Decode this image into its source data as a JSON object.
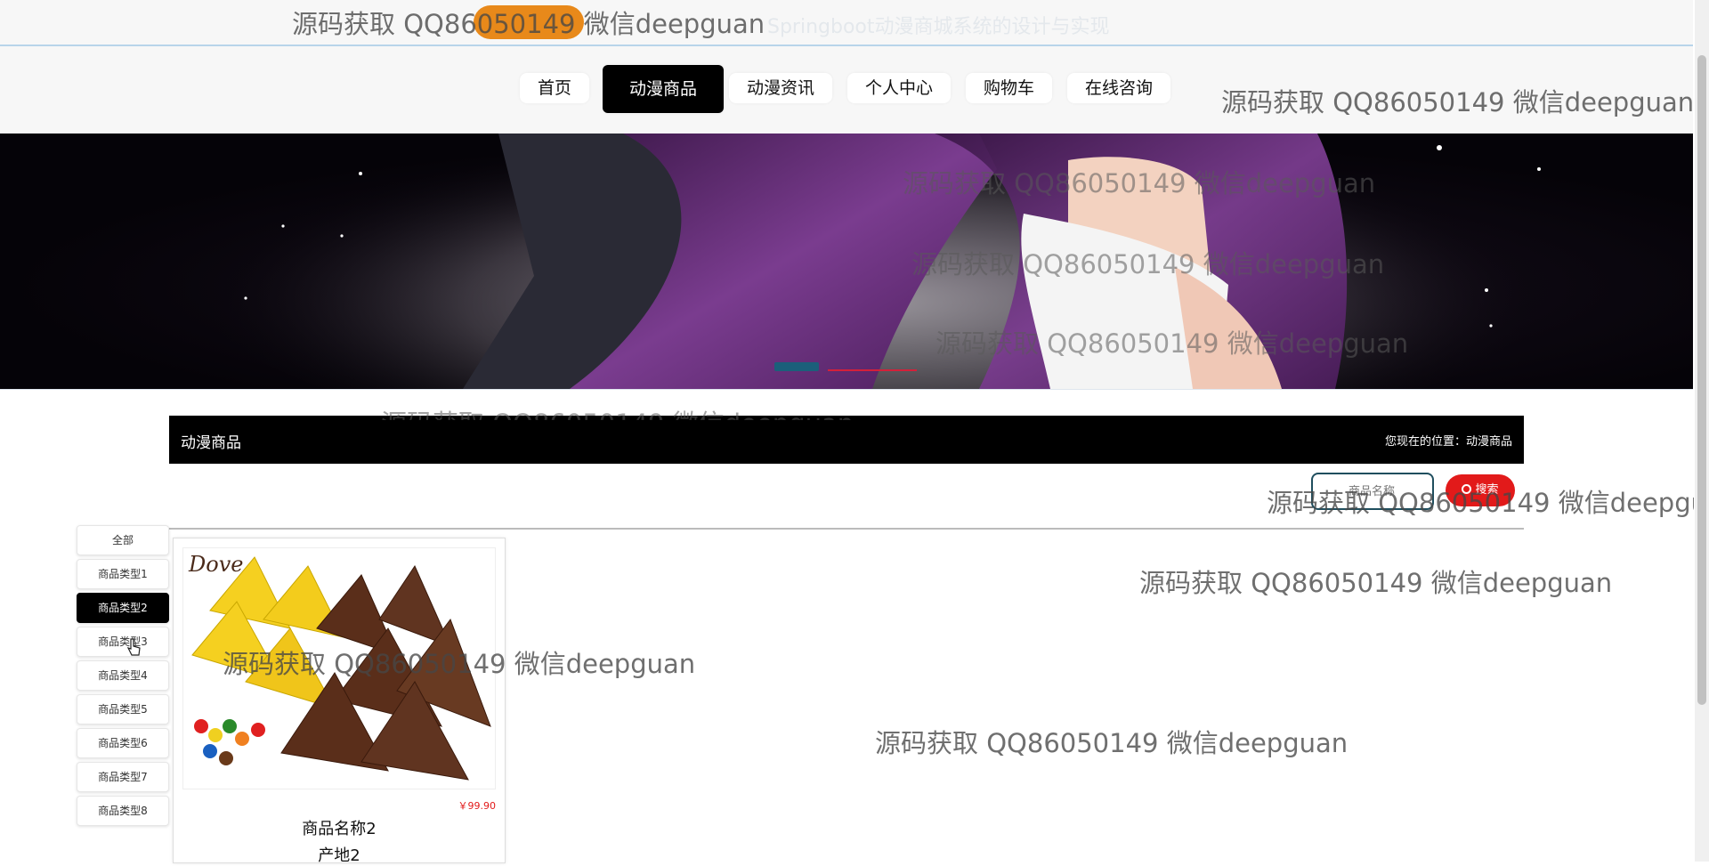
{
  "header": {
    "site_title": "Springboot动漫商城系统的设计与实现"
  },
  "nav": {
    "items": [
      "首页",
      "动漫商品",
      "动漫资讯",
      "个人中心",
      "购物车",
      "在线咨询"
    ],
    "active_index": 1
  },
  "section": {
    "title": "动漫商品",
    "breadcrumb": "您现在的位置：动漫商品"
  },
  "search": {
    "placeholder": "商品名称",
    "button_label": "搜索"
  },
  "categories": {
    "items": [
      "全部",
      "商品类型1",
      "商品类型2",
      "商品类型3",
      "商品类型4",
      "商品类型5",
      "商品类型6",
      "商品类型7",
      "商品类型8"
    ],
    "active_index": 2
  },
  "products": [
    {
      "image_brand": "Dove",
      "price": "￥99.90",
      "name": "商品名称2",
      "origin": "产地2"
    }
  ],
  "watermark": "源码获取 QQ86050149 微信deepguan",
  "colors": {
    "accent": "#000000",
    "search_button": "#e21a1a",
    "logo": "#e8891a"
  }
}
